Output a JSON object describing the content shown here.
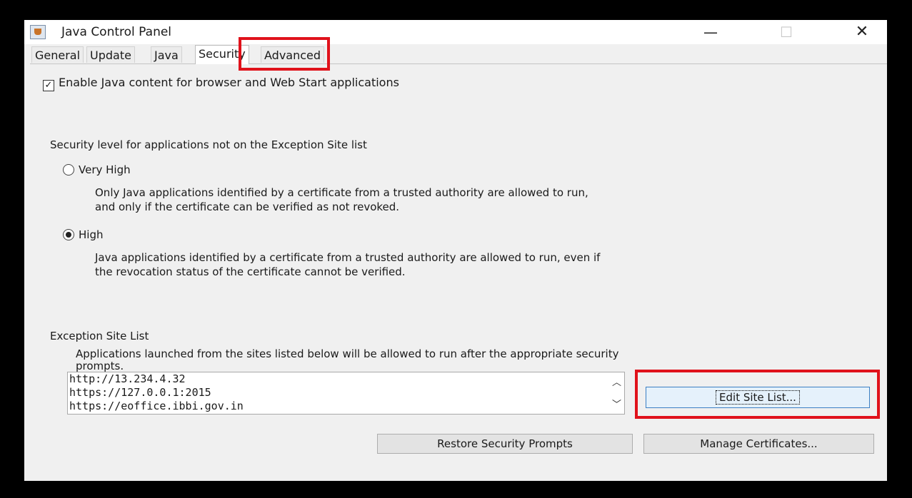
{
  "window": {
    "title": "Java Control Panel",
    "minimize_glyph": "—",
    "maximize_glyph": "☐",
    "close_glyph": "✕"
  },
  "tabs": [
    {
      "label": "General"
    },
    {
      "label": "Update"
    },
    {
      "label": "Java"
    },
    {
      "label": "Security"
    },
    {
      "label": "Advanced"
    }
  ],
  "active_tab": "Security",
  "enable_java": {
    "label": "Enable Java content for browser and Web Start applications",
    "checked": true,
    "check_glyph": "✓"
  },
  "security_level": {
    "heading": "Security level for applications not on the Exception Site list",
    "options": [
      {
        "label": "Very High",
        "checked": false,
        "description_line1": "Only Java applications identified by a certificate from a trusted authority are allowed to run,",
        "description_line2": "and only if the certificate can be verified as not revoked."
      },
      {
        "label": "High",
        "checked": true,
        "description_line1": "Java applications identified by a certificate from a trusted authority are allowed to run, even if",
        "description_line2": "the revocation status of the certificate cannot be verified."
      }
    ]
  },
  "exception_site_list": {
    "heading": "Exception Site List",
    "description_line1": "Applications launched from the sites listed below will be allowed to run after the appropriate security",
    "description_line2": "prompts.",
    "sites": [
      "http://13.234.4.32",
      "https://127.0.0.1:2015",
      "https://eoffice.ibbi.gov.in"
    ],
    "scroll_up_glyph": "︿",
    "scroll_down_glyph": "﹀",
    "edit_button": "Edit Site List..."
  },
  "buttons": {
    "restore_prompts": "Restore Security Prompts",
    "manage_certificates": "Manage Certificates..."
  },
  "colors": {
    "highlight": "#e0121b",
    "window_bg": "#f0f0f0"
  }
}
